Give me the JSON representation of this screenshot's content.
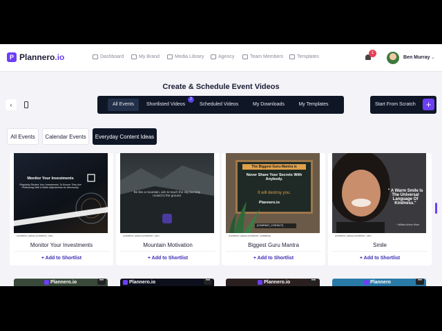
{
  "brand": {
    "name": "Plannero",
    "suffix": ".io"
  },
  "nav": [
    {
      "label": "Dashboard",
      "icon": "home-icon"
    },
    {
      "label": "My Brand",
      "icon": "briefcase-icon"
    },
    {
      "label": "Media Library",
      "icon": "image-icon"
    },
    {
      "label": "Agency",
      "icon": "building-icon"
    },
    {
      "label": "Team Members",
      "icon": "users-icon"
    },
    {
      "label": "Templates",
      "icon": "template-icon"
    }
  ],
  "notifications": {
    "count": "1"
  },
  "user": {
    "name": "Ben Murray"
  },
  "page_title": "Create & Schedule Event Videos",
  "tabs": [
    {
      "label": "All Events",
      "active": true
    },
    {
      "label": "Shortlisted Videos",
      "badge": "2"
    },
    {
      "label": "Scheduled Videos"
    },
    {
      "label": "My Downloads"
    },
    {
      "label": "My Templates"
    }
  ],
  "start_from_scratch": "Start From Scratch",
  "filters": [
    {
      "label": "All Events"
    },
    {
      "label": "Calendar Events"
    },
    {
      "label": "Everyday Content Ideas",
      "active": true
    }
  ],
  "cards": [
    {
      "title": "Monitor Your Investments",
      "add_label": "+ Add to Shortlist",
      "thumb": {
        "heading": "Monitor Your Investments",
        "body": "Regularly Review Your Investments To Ensure They Are Performing Well & Make Adjustments As Necessary.",
        "footer": "[COMPANY_EMAIL]   [COMPANY_URL]"
      }
    },
    {
      "title": "Mountain Motivation",
      "add_label": "+ Add to Shortlist",
      "thumb": {
        "quote": "Be like a mountain, aim to touch the sky but stay rooted to the ground.",
        "footer": "[COMPANY_EMAIL]   [COMPANY_URL]"
      }
    },
    {
      "title": "Biggest Guru Mantra",
      "add_label": "+ Add to Shortlist",
      "thumb": {
        "heading": "The Biggest Guru-Mantra is",
        "line1": "Never Share Your Secrets With Anybody.",
        "line2": "It will destroy you.",
        "brand": "Plannero.io",
        "contact": "[COMPANY_CONTACT]",
        "footer": "[COMPANY_EMAIL]   [COMPANY_ADDRESS]"
      }
    },
    {
      "title": "Smile",
      "add_label": "+ Add to Shortlist",
      "thumb": {
        "quote": "\" A Warm Smile Is The Universal Language Of Kindness.\"",
        "author": "~ William Arthur Ward",
        "footer": "[COMPANY_EMAIL]   [COMPANY_URL]"
      }
    }
  ],
  "second_row": [
    {
      "brand": "Plannero.io",
      "color": "#3a4a3a"
    },
    {
      "brand": "Plannero.io",
      "color": "#0d0f1c"
    },
    {
      "brand": "Plannero.io",
      "color": "#2a2020"
    },
    {
      "brand": "Plannero",
      "color": "#2a7aa8"
    }
  ],
  "more_label": "•••"
}
